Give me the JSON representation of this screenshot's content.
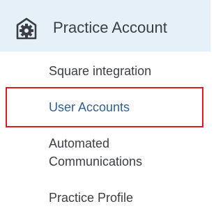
{
  "header": {
    "icon": "house-gear-icon",
    "title": "Practice Account"
  },
  "menu": {
    "items": [
      {
        "label": "Square integration",
        "active": false
      },
      {
        "label": "User Accounts",
        "active": true
      },
      {
        "label_line1": "Automated",
        "label_line2": "Communications",
        "active": false
      },
      {
        "label": "Practice Profile",
        "active": false
      }
    ]
  },
  "colors": {
    "header_bg": "#e6f0f8",
    "active_link": "#2e5f9e",
    "text": "#3b3f45",
    "highlight": "#dc1c24"
  }
}
